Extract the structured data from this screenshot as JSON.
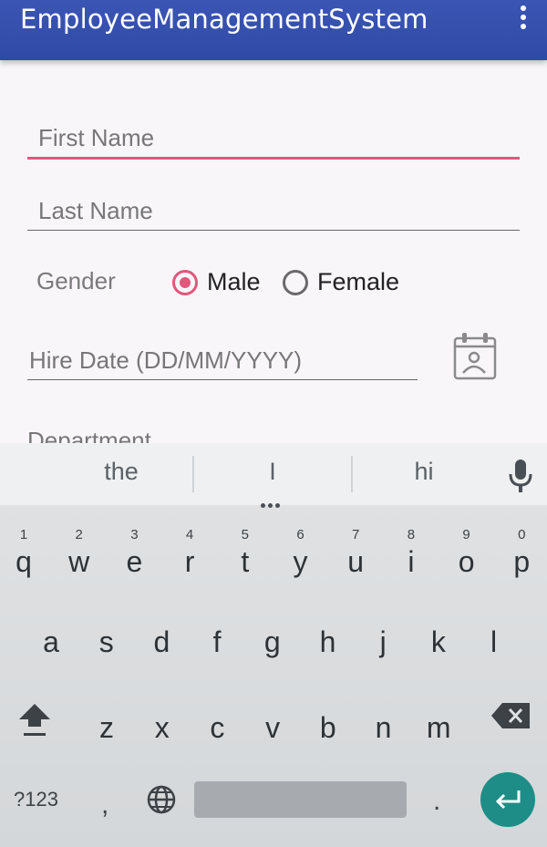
{
  "app": {
    "title": "EmployeeManagementSystem",
    "overflow_icon": "overflow-menu-icon"
  },
  "form": {
    "first_name": {
      "placeholder": "First Name",
      "value": ""
    },
    "last_name": {
      "placeholder": "Last Name",
      "value": ""
    },
    "gender": {
      "label": "Gender",
      "options": [
        {
          "label": "Male",
          "selected": true
        },
        {
          "label": "Female",
          "selected": false
        }
      ]
    },
    "hire_date": {
      "placeholder": "Hire Date (DD/MM/YYYY)",
      "value": "",
      "icon": "calendar-icon"
    },
    "department": {
      "label": "Department"
    }
  },
  "keyboard": {
    "suggestions": [
      "the",
      "I",
      "hi"
    ],
    "row1": [
      {
        "k": "q",
        "n": "1"
      },
      {
        "k": "w",
        "n": "2"
      },
      {
        "k": "e",
        "n": "3"
      },
      {
        "k": "r",
        "n": "4"
      },
      {
        "k": "t",
        "n": "5"
      },
      {
        "k": "y",
        "n": "6"
      },
      {
        "k": "u",
        "n": "7"
      },
      {
        "k": "i",
        "n": "8"
      },
      {
        "k": "o",
        "n": "9"
      },
      {
        "k": "p",
        "n": "0"
      }
    ],
    "row2": [
      "a",
      "s",
      "d",
      "f",
      "g",
      "h",
      "j",
      "k",
      "l"
    ],
    "row3": [
      "z",
      "x",
      "c",
      "v",
      "b",
      "n",
      "m"
    ],
    "symbols_key": "?123",
    "comma_key": ",",
    "period_key": ".",
    "accent_color": "#e2577c",
    "appbar_color": "#3b55b4",
    "enter_color": "#1e8d87"
  }
}
